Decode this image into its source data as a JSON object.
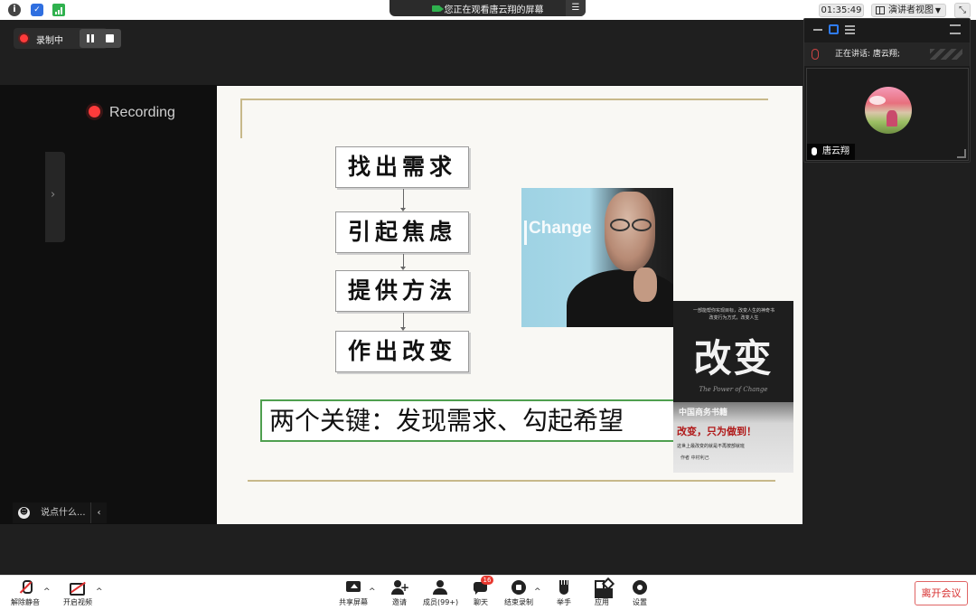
{
  "topbar": {
    "watching_text": "您正在观看唐云翔的屏幕",
    "clock": "01:35:49",
    "view_mode": "演讲者视图"
  },
  "recording": {
    "status_label": "录制中",
    "badge_label": "Recording",
    "accent": "#ff3b3b"
  },
  "slide": {
    "steps": [
      "找出需求",
      "引起焦虑",
      "提供方法",
      "作出改变"
    ],
    "key_points": "两个关键：发现需求、勾起希望",
    "photo_caption": "Change",
    "book": {
      "top_line1": "一部能帮你实现目标，改变人生的神奇书",
      "top_line2": "改变行为方式，改变人生",
      "title": "改变",
      "subtitle": "The Power of Change",
      "band_text": "中国商务书籍",
      "slogan": "改变，只为做到！",
      "blurb": "这世上最改变的就是不再按部就班",
      "author_line": "作者 中村利己"
    }
  },
  "chat_hint": "说点什么...",
  "right_panel": {
    "speaking_label": "正在讲话: 唐云翔;",
    "participant_name": "唐云翔"
  },
  "toolbar": {
    "unmute": "解除静音",
    "start_video": "开启视频",
    "share_screen": "共享屏幕",
    "invite": "邀请",
    "members": "成员(99+)",
    "chat": "聊天",
    "chat_badge": "16",
    "stop_recording": "结束录制",
    "raise_hand": "举手",
    "apps": "应用",
    "settings": "设置",
    "leave": "离开会议"
  }
}
